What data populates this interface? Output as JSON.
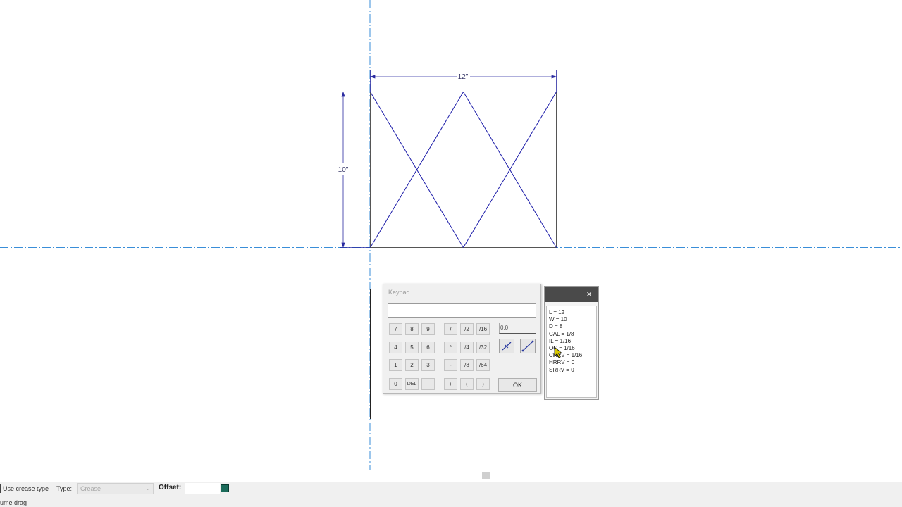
{
  "drawing": {
    "width_label": "12\"",
    "height_label": "10\"",
    "line_color": "#1a1aa8",
    "axis_color": "#3a8ed8"
  },
  "keypad": {
    "title": "Keypad",
    "display_value": "",
    "fraction_value": "0.0",
    "buttons": {
      "k7": "7",
      "k8": "8",
      "k9": "9",
      "k4": "4",
      "k5": "5",
      "k6": "6",
      "k1": "1",
      "k2": "2",
      "k3": "3",
      "k0": "0",
      "del": "DEL",
      "dot": ".",
      "divide": "/",
      "multiply": "*",
      "minus": "-",
      "plus": "+",
      "paren_open": "(",
      "paren_close": ")",
      "f2": "/2",
      "f4": "/4",
      "f8": "/8",
      "f16": "/16",
      "f32": "/32",
      "f64": "/64"
    },
    "ok_label": "OK"
  },
  "variables": {
    "close_label": "×",
    "lines": [
      "L  =  12",
      "W  =  10",
      "D  =  8",
      "CAL  =  1/8",
      "IL  =  1/16",
      "OC  =  1/16",
      "CHRV  =  1/16",
      "HRRV  =  0",
      "SRRV  =  0"
    ]
  },
  "options": {
    "use_crease_label": "Use crease type",
    "type_label": "Type:",
    "type_value": "Crease",
    "offset_label": "Offset:",
    "offset_value": "",
    "swatch_color": "#1b6b5a"
  },
  "status": {
    "text": "ume drag"
  }
}
